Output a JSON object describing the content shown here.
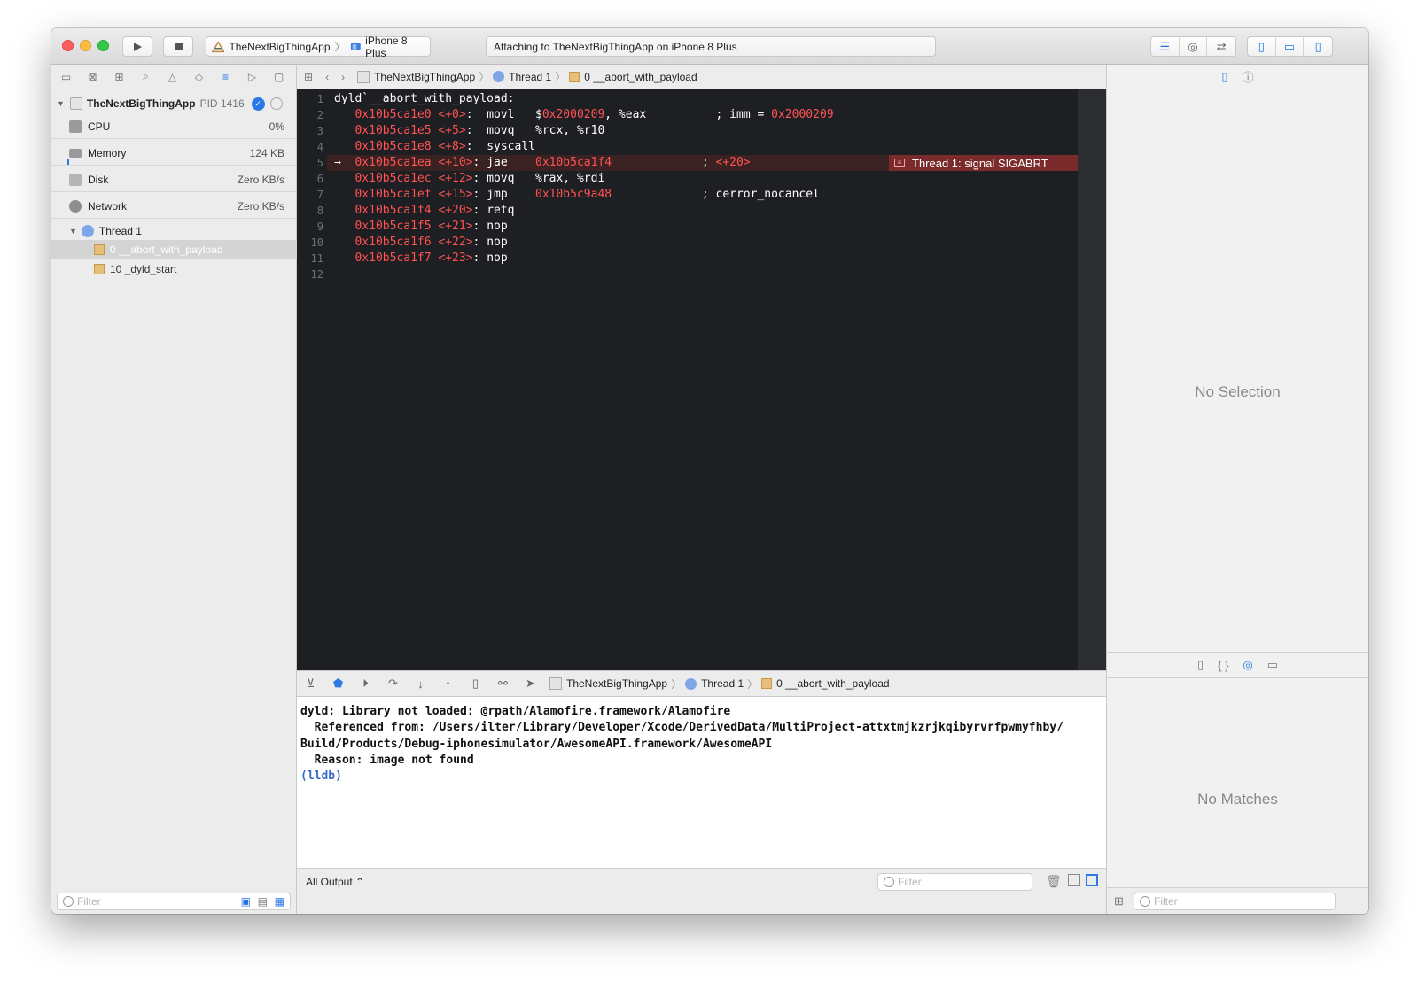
{
  "toolbar": {
    "scheme": "TheNextBigThingApp",
    "device": "iPhone 8 Plus",
    "activity": "Attaching to TheNextBigThingApp on iPhone 8 Plus"
  },
  "navigator": {
    "process": "TheNextBigThingApp",
    "pid": "PID 1416",
    "gauges": [
      {
        "label": "CPU",
        "value": "0%"
      },
      {
        "label": "Memory",
        "value": "124 KB"
      },
      {
        "label": "Disk",
        "value": "Zero KB/s"
      },
      {
        "label": "Network",
        "value": "Zero KB/s"
      }
    ],
    "thread": "Thread 1",
    "frames": [
      "0 __abort_with_payload",
      "10 _dyld_start"
    ],
    "filter_placeholder": "Filter"
  },
  "jumpbar": {
    "app": "TheNextBigThingApp",
    "thread": "Thread 1",
    "frame": "0 __abort_with_payload"
  },
  "editor": {
    "line_numbers": [
      "1",
      "2",
      "3",
      "4",
      "5",
      "6",
      "7",
      "8",
      "9",
      "10",
      "11",
      "12"
    ],
    "header": "dyld`__abort_with_payload:",
    "lines": [
      {
        "addr": "0x10b5ca1e0",
        "off": "<+0>",
        "instr": "movl",
        "operand_pre": "$",
        "operand_red": "0x2000209",
        "operand_post": ", %eax",
        "comment": "; imm = ",
        "comment_red": "0x2000209"
      },
      {
        "addr": "0x10b5ca1e5",
        "off": "<+5>",
        "instr": "movq",
        "operand_pre": "%rcx, %r10",
        "operand_red": "",
        "operand_post": "",
        "comment": "",
        "comment_red": ""
      },
      {
        "addr": "0x10b5ca1e8",
        "off": "<+8>",
        "instr": "syscall",
        "operand_pre": "",
        "operand_red": "",
        "operand_post": "",
        "comment": "",
        "comment_red": ""
      },
      {
        "addr": "0x10b5ca1ea",
        "off": "<+10>",
        "instr": "jae",
        "operand_pre": "",
        "operand_red": "0x10b5ca1f4",
        "operand_post": "",
        "comment": "; ",
        "comment_red": "<+20>"
      },
      {
        "addr": "0x10b5ca1ec",
        "off": "<+12>",
        "instr": "movq",
        "operand_pre": "%rax, %rdi",
        "operand_red": "",
        "operand_post": "",
        "comment": "",
        "comment_red": ""
      },
      {
        "addr": "0x10b5ca1ef",
        "off": "<+15>",
        "instr": "jmp",
        "operand_pre": "",
        "operand_red": "0x10b5c9a48",
        "operand_post": "",
        "comment": "; cerror_nocancel",
        "comment_red": ""
      },
      {
        "addr": "0x10b5ca1f4",
        "off": "<+20>",
        "instr": "retq",
        "operand_pre": "",
        "operand_red": "",
        "operand_post": "",
        "comment": "",
        "comment_red": ""
      },
      {
        "addr": "0x10b5ca1f5",
        "off": "<+21>",
        "instr": "nop",
        "operand_pre": "",
        "operand_red": "",
        "operand_post": "",
        "comment": "",
        "comment_red": ""
      },
      {
        "addr": "0x10b5ca1f6",
        "off": "<+22>",
        "instr": "nop",
        "operand_pre": "",
        "operand_red": "",
        "operand_post": "",
        "comment": "",
        "comment_red": ""
      },
      {
        "addr": "0x10b5ca1f7",
        "off": "<+23>",
        "instr": "nop",
        "operand_pre": "",
        "operand_red": "",
        "operand_post": "",
        "comment": "",
        "comment_red": ""
      }
    ],
    "current_marker": "→",
    "crash_label": "Thread 1: signal SIGABRT"
  },
  "debugbar": {
    "app": "TheNextBigThingApp",
    "thread": "Thread 1",
    "frame": "0 __abort_with_payload"
  },
  "console": {
    "lines": [
      "dyld: Library not loaded: @rpath/Alamofire.framework/Alamofire",
      "  Referenced from: /Users/ilter/Library/Developer/Xcode/DerivedData/MultiProject-attxtmjkzrjkqibyrvrfpwmyfhby/",
      "Build/Products/Debug-iphonesimulator/AwesomeAPI.framework/AwesomeAPI",
      "  Reason: image not found"
    ],
    "prompt": "(lldb)",
    "output_selector": "All Output ⌃",
    "filter_placeholder": "Filter"
  },
  "inspector": {
    "no_selection": "No Selection",
    "no_matches": "No Matches",
    "filter_placeholder": "Filter"
  },
  "colors": {
    "accent": "#1e74e6",
    "code_bg": "#1e1f23",
    "address_red": "#ff5252",
    "crash_bg": "#7a2a2a"
  }
}
